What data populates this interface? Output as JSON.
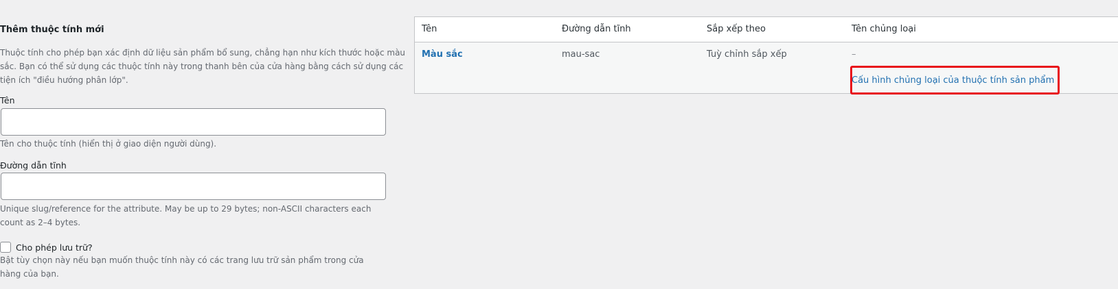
{
  "form": {
    "title": "Thêm thuộc tính mới",
    "intro": "Thuộc tính cho phép bạn xác định dữ liệu sản phẩm bổ sung, chẳng hạn như kích thước hoặc màu sắc. Bạn có thể sử dụng các thuộc tính này trong thanh bên của cửa hàng bằng cách sử dụng các tiện ích \"điều hướng phân lớp\".",
    "name_label": "Tên",
    "name_value": "",
    "name_help": "Tên cho thuộc tính (hiển thị ở giao diện người dùng).",
    "slug_label": "Đường dẫn tĩnh",
    "slug_value": "",
    "slug_help": "Unique slug/reference for the attribute. May be up to 29 bytes; non-ASCII characters each count as 2–4 bytes.",
    "archive_label": "Cho phép lưu trữ?",
    "archive_checked": false,
    "archive_help": "Bật tùy chọn này nếu bạn muốn thuộc tính này có các trang lưu trữ sản phẩm trong cửa hàng của bạn."
  },
  "table": {
    "columns": [
      "Tên",
      "Đường dẫn tĩnh",
      "Sắp xếp theo",
      "Tên chủng loại"
    ],
    "rows": [
      {
        "name": "Màu sắc",
        "slug": "mau-sac",
        "order_by": "Tuỳ chỉnh sắp xếp",
        "terms": "–",
        "configure_link": "Cấu hình chủng loại của thuộc tính sản phẩm"
      }
    ]
  },
  "colors": {
    "link": "#2271b1",
    "highlight": "#e8101a",
    "background": "#f0f0f1"
  }
}
